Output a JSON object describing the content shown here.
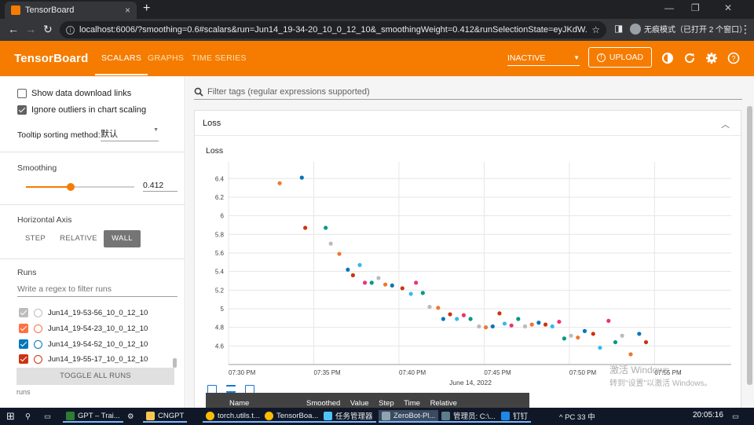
{
  "browser": {
    "tab_title": "TensorBoard",
    "url": "localhost:6006/?smoothing=0.6#scalars&run=Jun14_19-34-20_10_0_12_10&_smoothingWeight=0.412&runSelectionState=eyJKdW...",
    "incognito_label": "无痕模式（已打开 2 个窗口）",
    "close_tab": "×",
    "new_tab": "+"
  },
  "header": {
    "logo": "TensorBoard",
    "tabs": [
      "SCALARS",
      "GRAPHS",
      "TIME SERIES"
    ],
    "active_tab": "SCALARS",
    "inactive_select": "INACTIVE",
    "upload_label": "UPLOAD",
    "accent_color": "#f57c00"
  },
  "sidebar": {
    "show_download_links": "Show data download links",
    "ignore_outliers": "Ignore outliers in chart scaling",
    "tooltip_label": "Tooltip sorting method:",
    "tooltip_value": "默认",
    "smoothing_title": "Smoothing",
    "smoothing_value": "0.412",
    "smoothing_fraction": 0.412,
    "horizontal_axis_title": "Horizontal Axis",
    "axis_options": [
      "STEP",
      "RELATIVE",
      "WALL"
    ],
    "axis_selected": "WALL",
    "runs_title": "Runs",
    "runs_filter_placeholder": "Write a regex to filter runs",
    "runs": [
      {
        "name": "Jun14_19-53-56_10_0_12_10",
        "color": "#bdbdbd"
      },
      {
        "name": "Jun14_19-54-23_10_0_12_10",
        "color": "#ff7043"
      },
      {
        "name": "Jun14_19-54-52_10_0_12_10",
        "color": "#0077bb"
      },
      {
        "name": "Jun14_19-55-17_10_0_12_10",
        "color": "#cc3311"
      }
    ],
    "toggle_all": "TOGGLE ALL RUNS",
    "runs_footer": "runs"
  },
  "main": {
    "filter_placeholder": "Filter tags (regular expressions supported)",
    "card_title": "Loss",
    "tooltip_columns": "Smoothed Value Step Time Relative",
    "tooltip_name_col": "Name"
  },
  "chart_data": {
    "type": "scatter",
    "title": "Loss",
    "xlabel": "June 14, 2022",
    "ylabel": "",
    "x_ticks": [
      "07:30 PM",
      "07:35 PM",
      "07:40 PM",
      "07:45 PM",
      "07:50 PM",
      "07:55 PM"
    ],
    "x_unit": "minutes after 7:30 PM",
    "xlim": [
      0,
      29.5
    ],
    "y_ticks": [
      "6.4",
      "6.2",
      "6",
      "5.8",
      "5.6",
      "5.4",
      "5.2",
      "5",
      "4.8",
      "4.6"
    ],
    "ylim": [
      4.4,
      6.58
    ],
    "grid": true,
    "points": [
      {
        "x": 3.0,
        "y": 6.35,
        "c": "#ee7733"
      },
      {
        "x": 4.3,
        "y": 6.41,
        "c": "#0077bb"
      },
      {
        "x": 4.5,
        "y": 5.87,
        "c": "#cc3311"
      },
      {
        "x": 5.7,
        "y": 5.87,
        "c": "#009988"
      },
      {
        "x": 6.0,
        "y": 5.7,
        "c": "#bbbbbb"
      },
      {
        "x": 6.5,
        "y": 5.59,
        "c": "#ee7733"
      },
      {
        "x": 7.0,
        "y": 5.42,
        "c": "#0077bb"
      },
      {
        "x": 7.3,
        "y": 5.36,
        "c": "#cc3311"
      },
      {
        "x": 7.7,
        "y": 5.47,
        "c": "#33bbee"
      },
      {
        "x": 8.0,
        "y": 5.28,
        "c": "#ee3377"
      },
      {
        "x": 8.4,
        "y": 5.28,
        "c": "#009988"
      },
      {
        "x": 8.8,
        "y": 5.33,
        "c": "#bbbbbb"
      },
      {
        "x": 9.2,
        "y": 5.26,
        "c": "#ee7733"
      },
      {
        "x": 9.6,
        "y": 5.25,
        "c": "#0077bb"
      },
      {
        "x": 10.2,
        "y": 5.22,
        "c": "#cc3311"
      },
      {
        "x": 10.7,
        "y": 5.16,
        "c": "#33bbee"
      },
      {
        "x": 11.0,
        "y": 5.28,
        "c": "#ee3377"
      },
      {
        "x": 11.4,
        "y": 5.17,
        "c": "#009988"
      },
      {
        "x": 11.8,
        "y": 5.02,
        "c": "#bbbbbb"
      },
      {
        "x": 12.3,
        "y": 5.01,
        "c": "#ee7733"
      },
      {
        "x": 12.6,
        "y": 4.89,
        "c": "#0077bb"
      },
      {
        "x": 13.0,
        "y": 4.94,
        "c": "#cc3311"
      },
      {
        "x": 13.4,
        "y": 4.89,
        "c": "#33bbee"
      },
      {
        "x": 13.8,
        "y": 4.93,
        "c": "#ee3377"
      },
      {
        "x": 14.2,
        "y": 4.89,
        "c": "#009988"
      },
      {
        "x": 14.7,
        "y": 4.81,
        "c": "#bbbbbb"
      },
      {
        "x": 15.1,
        "y": 4.8,
        "c": "#ee7733"
      },
      {
        "x": 15.5,
        "y": 4.81,
        "c": "#0077bb"
      },
      {
        "x": 15.9,
        "y": 4.95,
        "c": "#cc3311"
      },
      {
        "x": 16.2,
        "y": 4.84,
        "c": "#33bbee"
      },
      {
        "x": 16.6,
        "y": 4.82,
        "c": "#ee3377"
      },
      {
        "x": 17.0,
        "y": 4.89,
        "c": "#009988"
      },
      {
        "x": 17.4,
        "y": 4.81,
        "c": "#bbbbbb"
      },
      {
        "x": 17.8,
        "y": 4.83,
        "c": "#ee7733"
      },
      {
        "x": 18.2,
        "y": 4.85,
        "c": "#0077bb"
      },
      {
        "x": 18.6,
        "y": 4.83,
        "c": "#cc3311"
      },
      {
        "x": 19.0,
        "y": 4.81,
        "c": "#33bbee"
      },
      {
        "x": 19.4,
        "y": 4.86,
        "c": "#ee3377"
      },
      {
        "x": 19.7,
        "y": 4.68,
        "c": "#009988"
      },
      {
        "x": 20.1,
        "y": 4.71,
        "c": "#bbbbbb"
      },
      {
        "x": 20.5,
        "y": 4.69,
        "c": "#ee7733"
      },
      {
        "x": 20.9,
        "y": 4.76,
        "c": "#0077bb"
      },
      {
        "x": 21.4,
        "y": 4.73,
        "c": "#cc3311"
      },
      {
        "x": 21.8,
        "y": 4.58,
        "c": "#33bbee"
      },
      {
        "x": 22.3,
        "y": 4.87,
        "c": "#ee3377"
      },
      {
        "x": 22.7,
        "y": 4.64,
        "c": "#009988"
      },
      {
        "x": 23.1,
        "y": 4.71,
        "c": "#bbbbbb"
      },
      {
        "x": 23.6,
        "y": 4.51,
        "c": "#ee7733"
      },
      {
        "x": 24.1,
        "y": 4.73,
        "c": "#0077bb"
      },
      {
        "x": 24.5,
        "y": 4.64,
        "c": "#cc3311"
      }
    ]
  },
  "watermark": {
    "line1": "激活 Windows",
    "line2": "转到\"设置\"以激活 Windows。"
  },
  "taskbar": {
    "items": [
      "GPT – Trai...",
      "CNGPT",
      "torch.utils.t...",
      "TensorBoa...",
      "任务管理器",
      "ZeroBot-Pl...",
      "管理员: C:\\...",
      "钉钉"
    ],
    "tray": "^ PC 33 中",
    "clock": "20:05:16"
  }
}
